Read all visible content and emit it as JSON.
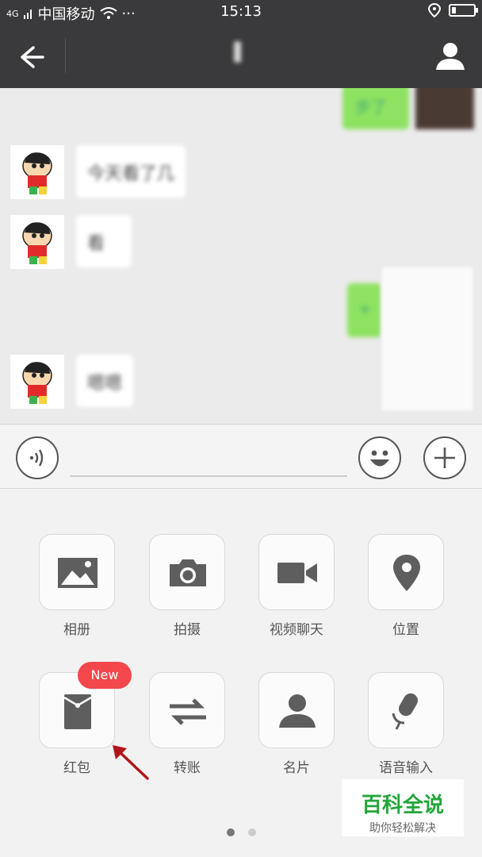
{
  "status_bar": {
    "signal": "4G",
    "carrier": "中国移动",
    "dots": "···",
    "time": "15:13"
  },
  "chat": {
    "messages": [
      {
        "from": "other",
        "text": "今天看了几"
      },
      {
        "from": "other",
        "text": "看"
      },
      {
        "from": "me",
        "text": "+"
      },
      {
        "from": "other",
        "text": "嗯嗯"
      }
    ],
    "top_right_text": "步了"
  },
  "panel": {
    "items": [
      {
        "label": "相册",
        "icon": "picture-icon"
      },
      {
        "label": "拍摄",
        "icon": "camera-icon"
      },
      {
        "label": "视频聊天",
        "icon": "video-camera-icon"
      },
      {
        "label": "位置",
        "icon": "location-pin-icon"
      },
      {
        "label": "红包",
        "icon": "red-packet-icon",
        "badge": "New"
      },
      {
        "label": "转账",
        "icon": "transfer-arrows-icon"
      },
      {
        "label": "名片",
        "icon": "contact-card-icon"
      },
      {
        "label": "语音输入",
        "icon": "microphone-icon"
      }
    ],
    "page_index": 1,
    "page_count": 2
  },
  "watermark": {
    "title": "百科全说",
    "subtitle": "助你轻松解决"
  },
  "colors": {
    "bar": "#3a3a3c",
    "badge": "#f3474c",
    "bubble_green": "#8ee261",
    "watermark_green": "#22a63a",
    "arrow": "#b0151b"
  }
}
